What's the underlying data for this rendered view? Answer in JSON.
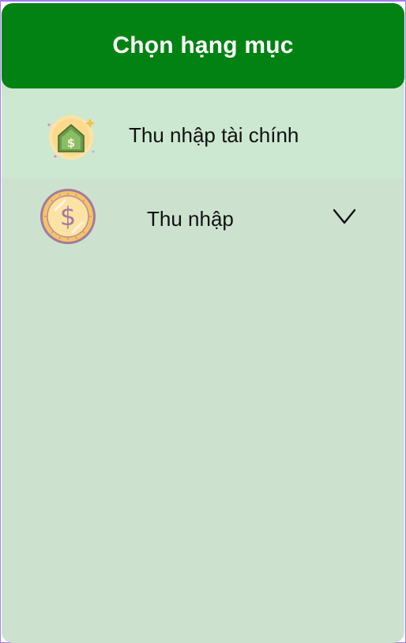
{
  "header": {
    "title": "Chọn hạng mục"
  },
  "categories": [
    {
      "label": "Thu nhập tài chính",
      "icon": "money-house-icon"
    },
    {
      "label": "Thu nhập",
      "icon": "dollar-coin-icon",
      "expand_icon": "chevron-down-icon"
    }
  ],
  "colors": {
    "header_bg": "#028212",
    "panel_bg": "#cce2cf",
    "selected_row_bg": "#cde8d1",
    "frame_border": "#a57cf0"
  }
}
